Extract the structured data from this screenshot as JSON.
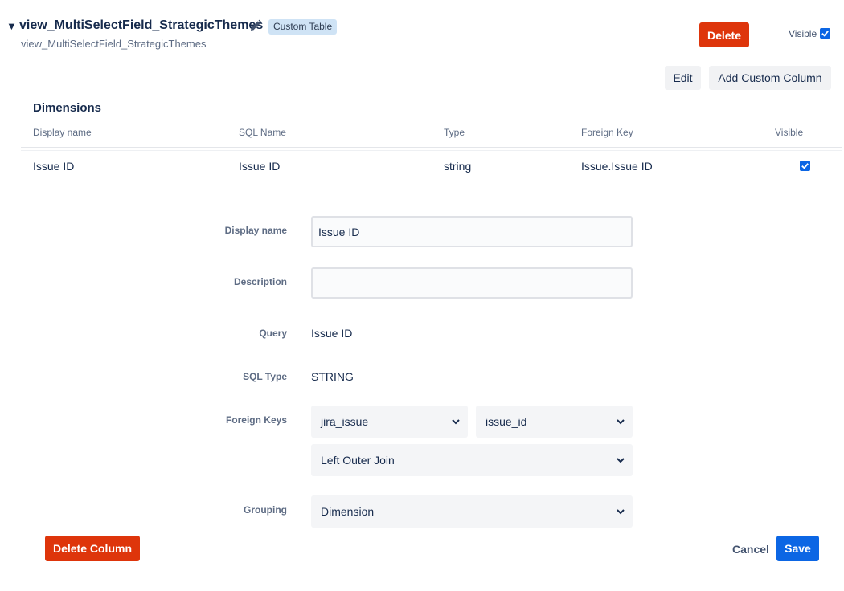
{
  "view": {
    "toggle_icon": "triangle-down-icon",
    "title": "view_MultiSelectField_StrategicThemes",
    "edit_icon": "pencil-icon",
    "badge": "Custom Table",
    "subtitle": "view_MultiSelectField_StrategicThemes",
    "delete_label": "Delete",
    "visible_label": "Visible",
    "visible_checked": true,
    "edit_label": "Edit",
    "add_custom_column_label": "Add Custom Column"
  },
  "dimensions": {
    "title": "Dimensions",
    "columns": [
      "Display name",
      "SQL Name",
      "Type",
      "Foreign Key",
      "Visible"
    ],
    "rows": [
      {
        "display_name": "Issue ID",
        "sql_name": "Issue ID",
        "type": "string",
        "foreign_key": "Issue.Issue ID",
        "visible": true
      }
    ]
  },
  "form": {
    "display_name_label": "Display name",
    "display_name_value": "Issue ID",
    "description_label": "Description",
    "description_value": "",
    "query_label": "Query",
    "query_value": "Issue ID",
    "sql_type_label": "SQL Type",
    "sql_type_value": "STRING",
    "foreign_keys_label": "Foreign Keys",
    "fk_table": "jira_issue",
    "fk_column": "issue_id",
    "join_type": "Left Outer Join",
    "grouping_label": "Grouping",
    "grouping_value": "Dimension"
  },
  "actions": {
    "delete_column_label": "Delete Column",
    "cancel_label": "Cancel",
    "save_label": "Save"
  },
  "colors": {
    "danger": "#de350b",
    "primary": "#0c66e4",
    "badge_bg": "#cfe3f5"
  }
}
